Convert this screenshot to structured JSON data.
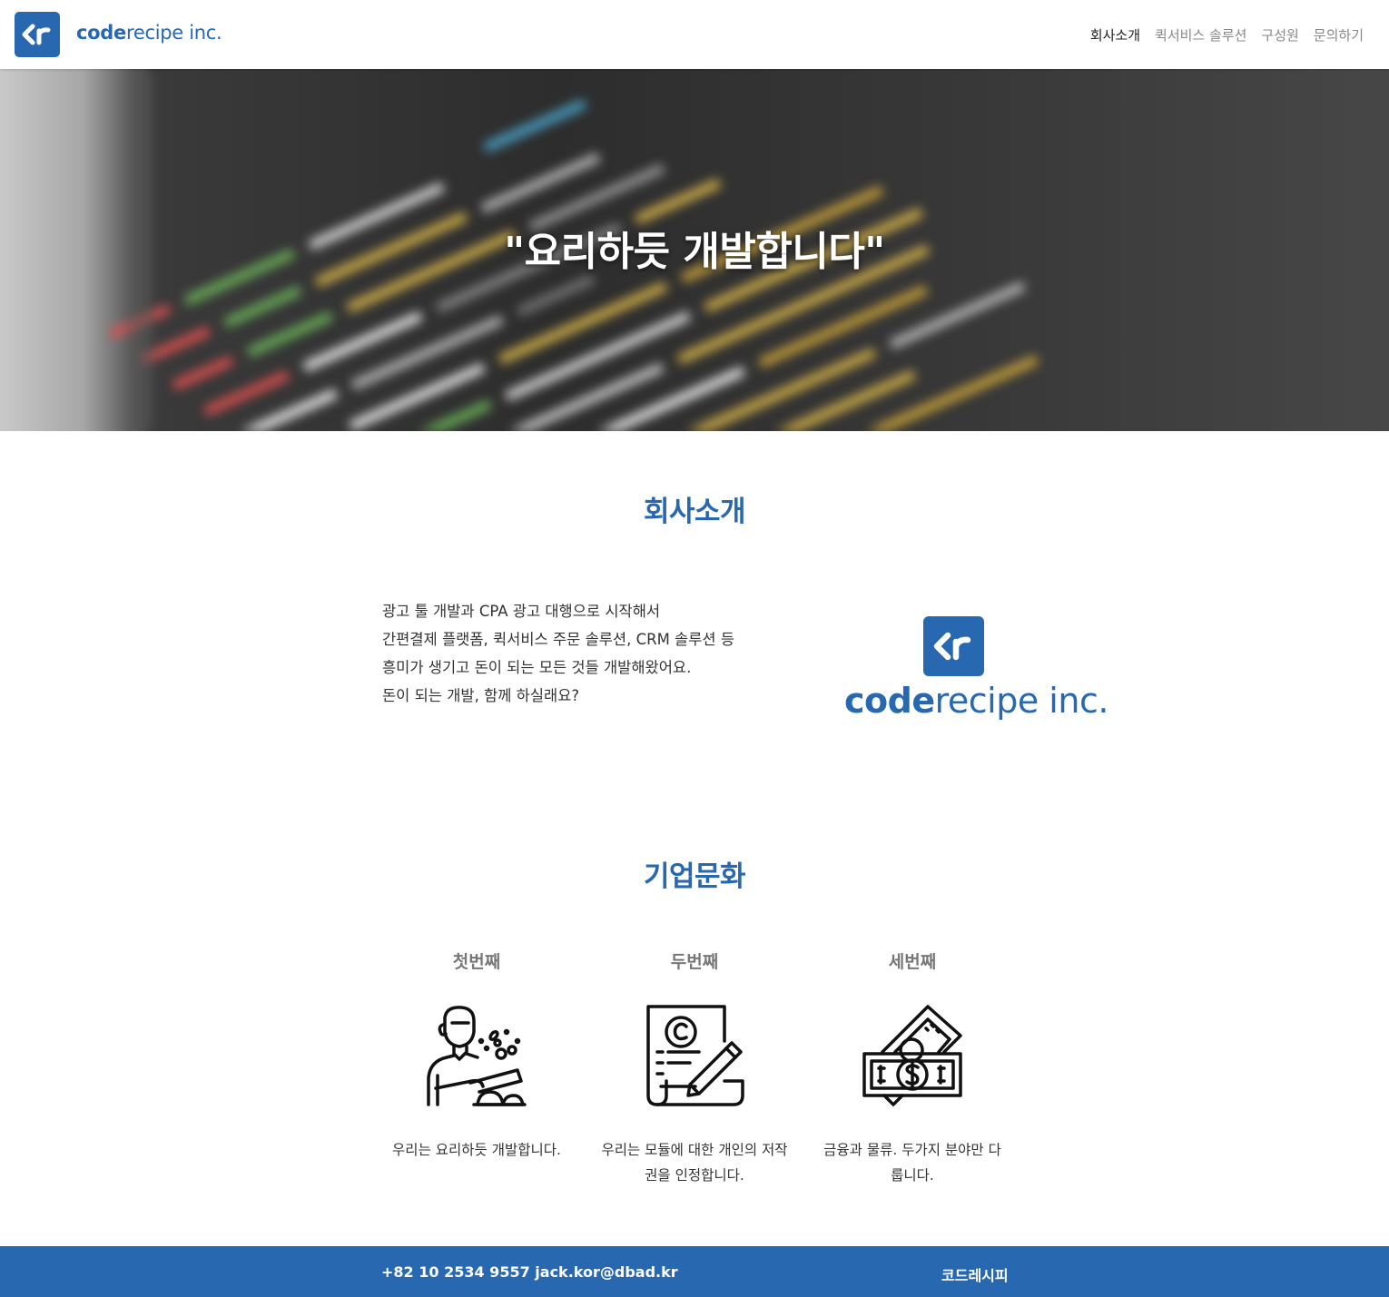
{
  "header": {
    "logo": {
      "bold": "code",
      "rest": "recipe inc."
    },
    "nav": [
      "회사소개",
      "퀵서비스 솔루션",
      "구성원",
      "문의하기"
    ]
  },
  "hero": {
    "title": "\"요리하듯 개발합니다\""
  },
  "about": {
    "title": "회사소개",
    "lines": [
      "광고 툴 개발과 CPA 광고 대행으로 시작해서",
      "간편결제 플랫폼, 퀵서비스 주문 솔루션, CRM 솔루션 등",
      "흥미가 생기고 돈이 되는 모든 것들 개발해왔어요.",
      "돈이 되는 개발, 함께 하실래요?"
    ],
    "logo": {
      "bold": "code",
      "rest": "recipe inc."
    }
  },
  "culture": {
    "title": "기업문화",
    "items": [
      {
        "title": "첫번째",
        "icon": "chef-cooking-icon",
        "desc": "우리는 요리하듯 개발합니다."
      },
      {
        "title": "두번째",
        "icon": "copyright-document-icon",
        "desc": "우리는 모듈에 대한 개인의 저작권을 인정합니다."
      },
      {
        "title": "세번째",
        "icon": "money-bills-icon",
        "desc": "금융과 물류. 두가지 분야만 다룹니다."
      }
    ]
  },
  "footer": {
    "contact": "+82 10 2534 9557 jack.kor@dbad.kr",
    "brand": "코드레시피"
  },
  "colors": {
    "brand": "#2868b0",
    "footer_bg": "#2868b0",
    "nav_active": "#222222",
    "nav_inactive": "#888888"
  }
}
